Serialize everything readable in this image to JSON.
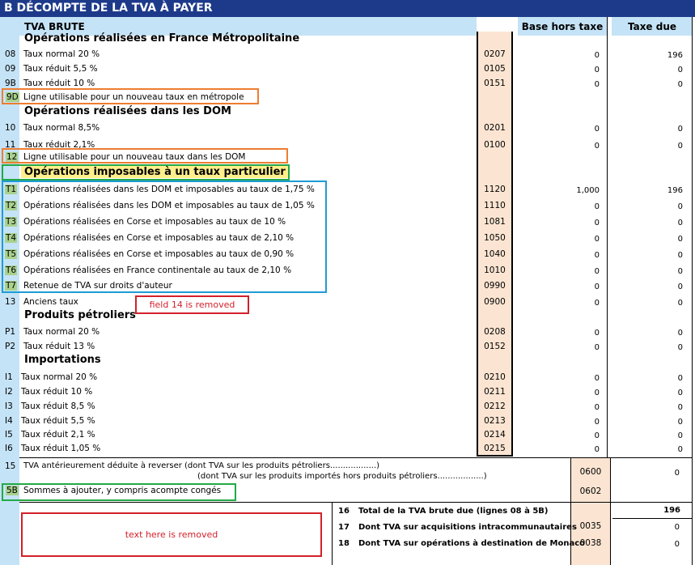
{
  "header": {
    "title": "B DÉCOMPTE DE LA TVA À PAYER",
    "subtitle": "TVA BRUTE",
    "col_base": "Base hors taxe",
    "col_tax": "Taxe due"
  },
  "sections": {
    "metro": "Opérations réalisées en France Métropolitaine",
    "dom": "Opérations réalisées dans les DOM",
    "particulier": "Opérations imposables à un taux particulier",
    "petroliers": "Produits pétroliers",
    "importations": "Importations"
  },
  "rows": {
    "r08": {
      "num": "08",
      "label": "Taux normal 20 %",
      "code": "0207",
      "base": "0",
      "tax": "196"
    },
    "r09": {
      "num": "09",
      "label": "Taux réduit 5,5 %",
      "code": "0105",
      "base": "0",
      "tax": "0"
    },
    "r9b": {
      "num": "9B",
      "label": "Taux réduit 10 %",
      "code": "0151",
      "base": "0",
      "tax": "0"
    },
    "r9d": {
      "num": "9D",
      "label": "Ligne utilisable pour un nouveau taux en métropole"
    },
    "r10": {
      "num": "10",
      "label": "Taux normal 8,5%",
      "code": "0201",
      "base": "0",
      "tax": "0"
    },
    "r11": {
      "num": "11",
      "label": "Taux réduit 2,1%",
      "code": "0100",
      "base": "0",
      "tax": "0"
    },
    "r12": {
      "num": "12",
      "label": "Ligne utilisable pour un nouveau taux dans les DOM"
    },
    "t1": {
      "num": "T1",
      "label": "Opérations réalisées dans les DOM et imposables au taux de 1,75 %",
      "code": "1120",
      "base": "1,000",
      "tax": "196"
    },
    "t2": {
      "num": "T2",
      "label": "Opérations réalisées dans les DOM et imposables au taux de 1,05 %",
      "code": "1110",
      "base": "0",
      "tax": "0"
    },
    "t3": {
      "num": "T3",
      "label": "Opérations réalisées en Corse et imposables au taux de 10 %",
      "code": "1081",
      "base": "0",
      "tax": "0"
    },
    "t4": {
      "num": "T4",
      "label": "Opérations réalisées en Corse et imposables au taux de 2,10 %",
      "code": "1050",
      "base": "0",
      "tax": "0"
    },
    "t5": {
      "num": "T5",
      "label": "Opérations réalisées en Corse et imposables au taux de 0,90 %",
      "code": "1040",
      "base": "0",
      "tax": "0"
    },
    "t6": {
      "num": "T6",
      "label": "Opérations réalisées en France continentale au taux de 2,10 %",
      "code": "1010",
      "base": "0",
      "tax": "0"
    },
    "t7": {
      "num": "T7",
      "label": "Retenue de TVA sur droits d'auteur",
      "code": "0990",
      "base": "0",
      "tax": "0"
    },
    "r13": {
      "num": "13",
      "label": "Anciens taux",
      "code": "0900",
      "base": "0",
      "tax": "0"
    },
    "p1": {
      "num": "P1",
      "label": "Taux normal 20 %",
      "code": "0208",
      "base": "0",
      "tax": "0"
    },
    "p2": {
      "num": "P2",
      "label": "Taux réduit 13 %",
      "code": "0152",
      "base": "0",
      "tax": "0"
    },
    "i1": {
      "num": "I1",
      "label": "Taux normal 20 %",
      "code": "0210",
      "base": "0",
      "tax": "0"
    },
    "i2": {
      "num": "I2",
      "label": "Taux réduit 10 %",
      "code": "0211",
      "base": "0",
      "tax": "0"
    },
    "i3": {
      "num": "I3",
      "label": "Taux réduit 8,5 %",
      "code": "0212",
      "base": "0",
      "tax": "0"
    },
    "i4": {
      "num": "I4",
      "label": "Taux réduit 5,5 %",
      "code": "0213",
      "base": "0",
      "tax": "0"
    },
    "i5": {
      "num": "I5",
      "label": "Taux réduit 2,1 %",
      "code": "0214",
      "base": "0",
      "tax": "0"
    },
    "i6": {
      "num": "I6",
      "label": "Taux réduit 1,05 %",
      "code": "0215",
      "base": "0",
      "tax": "0"
    }
  },
  "notes": {
    "field14": "field 14 is removed",
    "textremoved": "text here is removed"
  },
  "line15": {
    "num": "15",
    "text1": "TVA antérieurement déduite à reverser (dont TVA sur les produits pétroliers..................)",
    "text2": "(dont TVA sur les produits importés hors produits pétroliers..................)",
    "code": "0600",
    "tax": "0"
  },
  "line5b": {
    "num": "5B",
    "label": "Sommes à ajouter, y compris acompte congés",
    "code": "0602"
  },
  "totals": {
    "r16": {
      "num": "16",
      "label": "Total de la TVA brute due (lignes 08 à 5B)",
      "tax": "196"
    },
    "r17": {
      "num": "17",
      "label": "Dont TVA sur acquisitions intracommunautaires",
      "code": "0035",
      "tax": "0"
    },
    "r18": {
      "num": "18",
      "label": "Dont TVA sur opérations à destination de Monaco",
      "code": "0038",
      "tax": "0"
    }
  }
}
